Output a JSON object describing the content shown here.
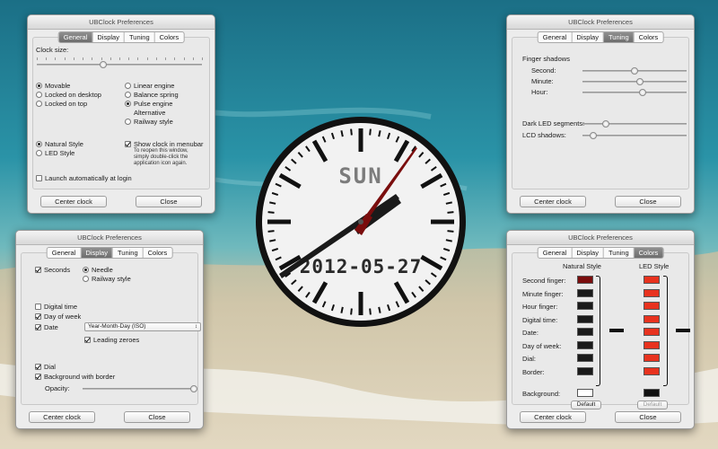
{
  "window_title": "UBClock Preferences",
  "tabs": [
    "General",
    "Display",
    "Tuning",
    "Colors"
  ],
  "buttons": {
    "center": "Center clock",
    "close": "Close"
  },
  "general": {
    "clock_size_label": "Clock size:",
    "clock_size_value": 0.4,
    "movement": [
      {
        "label": "Movable",
        "selected": true
      },
      {
        "label": "Locked on desktop",
        "selected": false
      },
      {
        "label": "Locked on top",
        "selected": false
      }
    ],
    "engines": [
      {
        "label": "Linear engine",
        "selected": false
      },
      {
        "label": "Balance spring",
        "selected": false
      },
      {
        "label": "Pulse engine",
        "selected": true
      },
      {
        "label": "Alternative",
        "selected": false
      },
      {
        "label": "Railway style",
        "selected": false
      }
    ],
    "styles": [
      {
        "label": "Natural Style",
        "selected": true
      },
      {
        "label": "LED Style",
        "selected": false
      }
    ],
    "show_menubar_label": "Show clock in menubar",
    "show_menubar_checked": true,
    "reopen_note": [
      "To reopen this window,",
      "simply double-click the",
      "application icon again."
    ],
    "launch_label": "Launch automatically at login",
    "launch_checked": false
  },
  "display": {
    "seconds_label": "Seconds",
    "seconds_checked": true,
    "hand_styles": [
      {
        "label": "Needle",
        "selected": true
      },
      {
        "label": "Railway style",
        "selected": false
      }
    ],
    "digital_time_label": "Digital time",
    "digital_time_checked": false,
    "day_of_week_label": "Day of week",
    "day_of_week_checked": true,
    "date_label": "Date",
    "date_checked": true,
    "date_format": "Year-Month-Day (ISO)",
    "leading_zeroes_label": "Leading zeroes",
    "leading_zeroes_checked": true,
    "dial_label": "Dial",
    "dial_checked": true,
    "background_label": "Background with border",
    "background_checked": true,
    "opacity_label": "Opacity:",
    "opacity_value": 1.0
  },
  "tuning": {
    "section_label": "Finger shadows",
    "second_label": "Second:",
    "second_value": 0.5,
    "minute_label": "Minute:",
    "minute_value": 0.55,
    "hour_label": "Hour:",
    "hour_value": 0.58,
    "dark_led_label": "Dark LED segments:",
    "dark_led_value": 0.22,
    "lcd_label": "LCD shadows:",
    "lcd_value": 0.1
  },
  "colors": {
    "natural_header": "Natural Style",
    "led_header": "LED Style",
    "rows": [
      {
        "label": "Second finger:",
        "natural": "#7a0d0d",
        "led": "#e8321e"
      },
      {
        "label": "Minute finger:",
        "natural": "#1a1a1a",
        "led": "#e8321e"
      },
      {
        "label": "Hour finger:",
        "natural": "#1a1a1a",
        "led": "#e8321e"
      },
      {
        "label": "Digital time:",
        "natural": "#1a1a1a",
        "led": "#e8321e"
      },
      {
        "label": "Date:",
        "natural": "#1a1a1a",
        "led": "#e8321e"
      },
      {
        "label": "Day of week:",
        "natural": "#1a1a1a",
        "led": "#e8321e"
      },
      {
        "label": "Dial:",
        "natural": "#1a1a1a",
        "led": "#e8321e"
      },
      {
        "label": "Border:",
        "natural": "#1a1a1a",
        "led": "#e8321e"
      }
    ],
    "background_label": "Background:",
    "background_natural": "#ffffff",
    "background_led": "#111111",
    "default_label": "Default"
  },
  "clock": {
    "day": "SUN",
    "date": "2012-05-27",
    "hour_hand_color": "#1a1a1a",
    "minute_hand_color": "#1a1a1a",
    "second_hand_color": "#7a0d0d"
  }
}
